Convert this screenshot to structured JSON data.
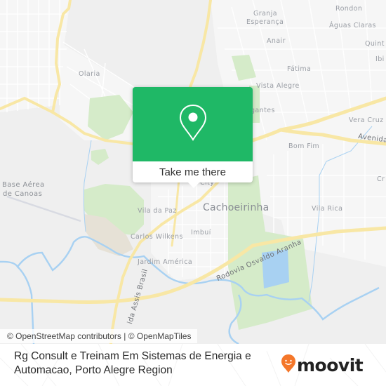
{
  "map": {
    "labels": {
      "olaria": "Olaria",
      "granja_esperanca_1": "Granja",
      "granja_esperanca_2": "Esperança",
      "rondon": "Rondon",
      "aguas_claras": "Águas Claras",
      "anair": "Anair",
      "quinta": "Quint",
      "ibi": "Ibi",
      "fatima": "Fátima",
      "vista_alegre": "Vista Alegre",
      "navegantes": "gantes",
      "vera_cruz": "Vera Cruz",
      "avenida": "Avenida",
      "bom_fim": "Bom Fim",
      "base_aerea_1": "Base Aérea",
      "base_aerea_2": "de Canoas",
      "city": "City",
      "cachoeirinha": "Cachoeirinha",
      "vila_da_paz": "Vila da Paz",
      "vila_rica": "Vila Rica",
      "carlos_wilkens": "Carlos Wilkens",
      "imbui": "Imbuí",
      "jardim_america": "Jardim América",
      "rodovia_osvaldo_aranha": "Rodovia Osvaldo Aranha",
      "avenida_assis_brasil": "ida Assis Brasil",
      "cruz_partial": "Cr"
    },
    "colors": {
      "background": "#efefef",
      "road_major": "#f8e7a5",
      "road_minor": "#ffffff",
      "park": "#d5ebc9",
      "water": "#a8d1f2",
      "urban_sand": "#e6e1d6"
    }
  },
  "popup": {
    "icon": "map-pin-icon",
    "action_label": "Take me there",
    "accent_color": "#1fb866"
  },
  "attribution": "© OpenStreetMap contributors | © OpenMapTiles",
  "footer": {
    "place_name": "Rg Consult e Treinam Em Sistemas de Energia e Automacao, Porto Alegre Region",
    "brand": {
      "name": "moovit",
      "icon": "moovit-face-pin-icon",
      "icon_color": "#f4772a"
    }
  }
}
